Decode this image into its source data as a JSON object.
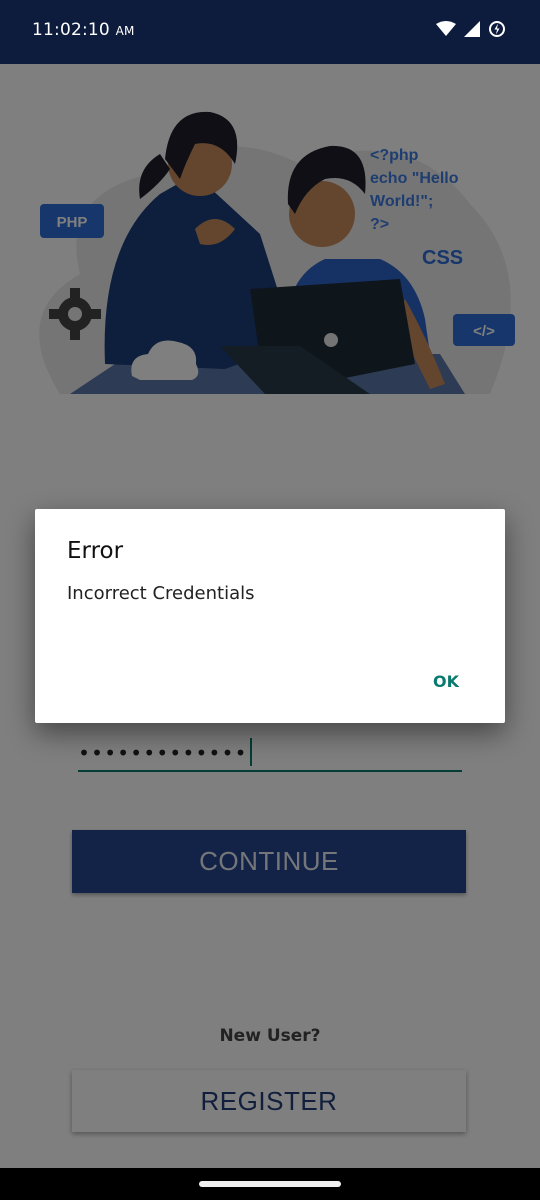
{
  "status_bar": {
    "time": "11:02:10",
    "ampm": "AM",
    "icons": [
      "wifi-icon",
      "cell-signal-icon",
      "battery-saver-icon"
    ]
  },
  "illustration": {
    "labels": {
      "php_badge": "PHP",
      "code_line_1": "<?php",
      "code_line_2": "echo \"Hello",
      "code_line_3": "World!\";",
      "code_line_4": "?>",
      "css": "CSS",
      "tag_badge": "</>"
    }
  },
  "login": {
    "password_value": "•••••••••••••",
    "continue_label": "CONTINUE",
    "new_user_label": "New User?",
    "register_label": "REGISTER"
  },
  "dialog": {
    "title": "Error",
    "message": "Incorrect Credentials",
    "ok_label": "OK"
  },
  "colors": {
    "status_bar": "#0d1b3d",
    "primary": "#24468e",
    "accent": "#0a7a6e",
    "scrim": "rgba(0,0,0,0.5)"
  }
}
